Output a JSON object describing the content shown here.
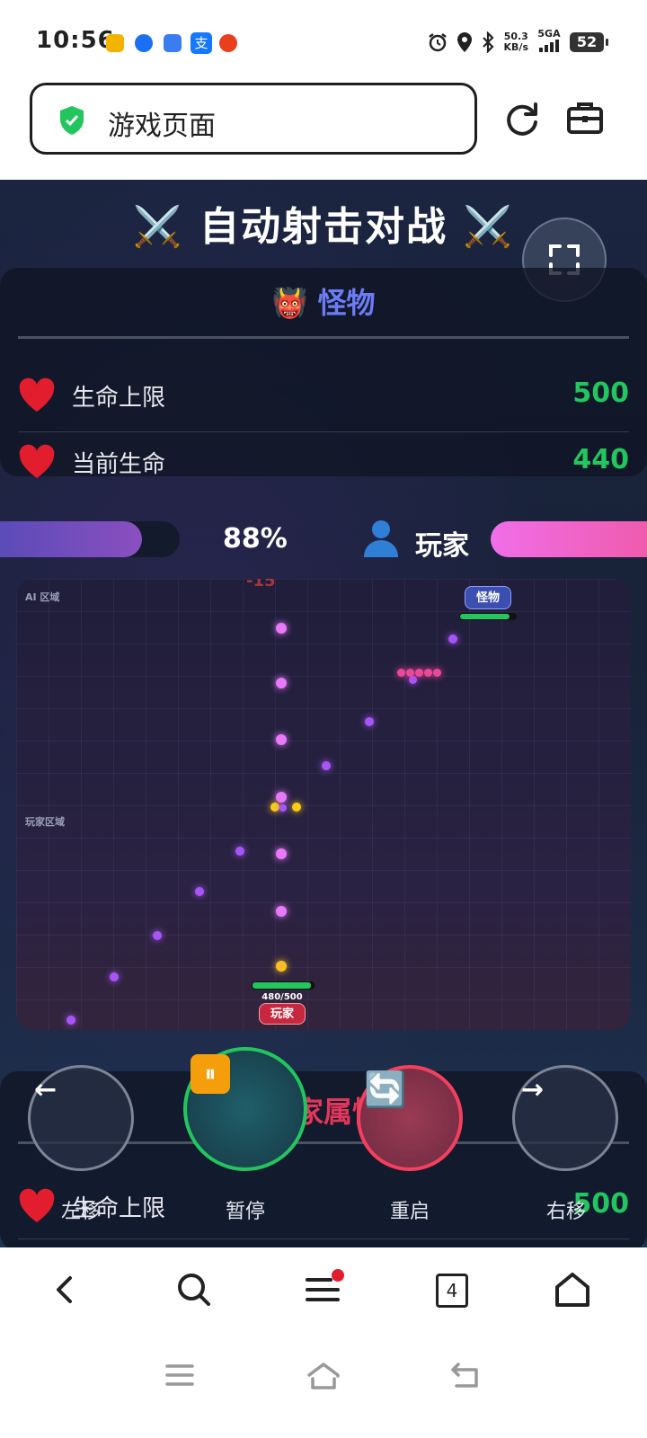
{
  "status_bar": {
    "time": "10:56",
    "net_speed": "50.3",
    "net_unit": "KB/s",
    "signal": "5GA",
    "battery": "52",
    "icons": [
      "alarm-icon",
      "location-icon",
      "bluetooth-icon",
      "signal-icon"
    ]
  },
  "browser": {
    "url_text": "游戏页面",
    "shield_color": "#22c55e",
    "tab_count": "4"
  },
  "game": {
    "title": "⚔️ 自动射击对战 ⚔️",
    "monster_panel": {
      "emoji": "👹",
      "title": "怪物",
      "title_color": "#6b7cf5",
      "max_hp_label": "生命上限",
      "max_hp_value": "500",
      "current_hp_label": "当前生命",
      "current_hp_value": "440"
    },
    "hp_bar": {
      "percent_text": "88%",
      "fill_fraction": 0.88,
      "player_label": "玩家"
    },
    "arena": {
      "ai_zone_label": "AI 区域",
      "player_zone_label": "玩家区域",
      "enemy_tag": "怪物",
      "enemy_hp_fraction": 0.88,
      "player_tag": "玩家",
      "player_hp_text": "480/500",
      "player_hp_fraction": 0.96,
      "damage_text": "-15"
    },
    "player_panel": {
      "title": "玩家属性",
      "max_hp_label": "生命上限",
      "max_hp_value": "500"
    },
    "controls": {
      "left_label": "左移",
      "left_glyph": "←",
      "pause_label": "暂停",
      "pause_glyph": "⏸",
      "restart_label": "重启",
      "restart_glyph": "🔄",
      "right_label": "右移",
      "right_glyph": "→"
    }
  }
}
